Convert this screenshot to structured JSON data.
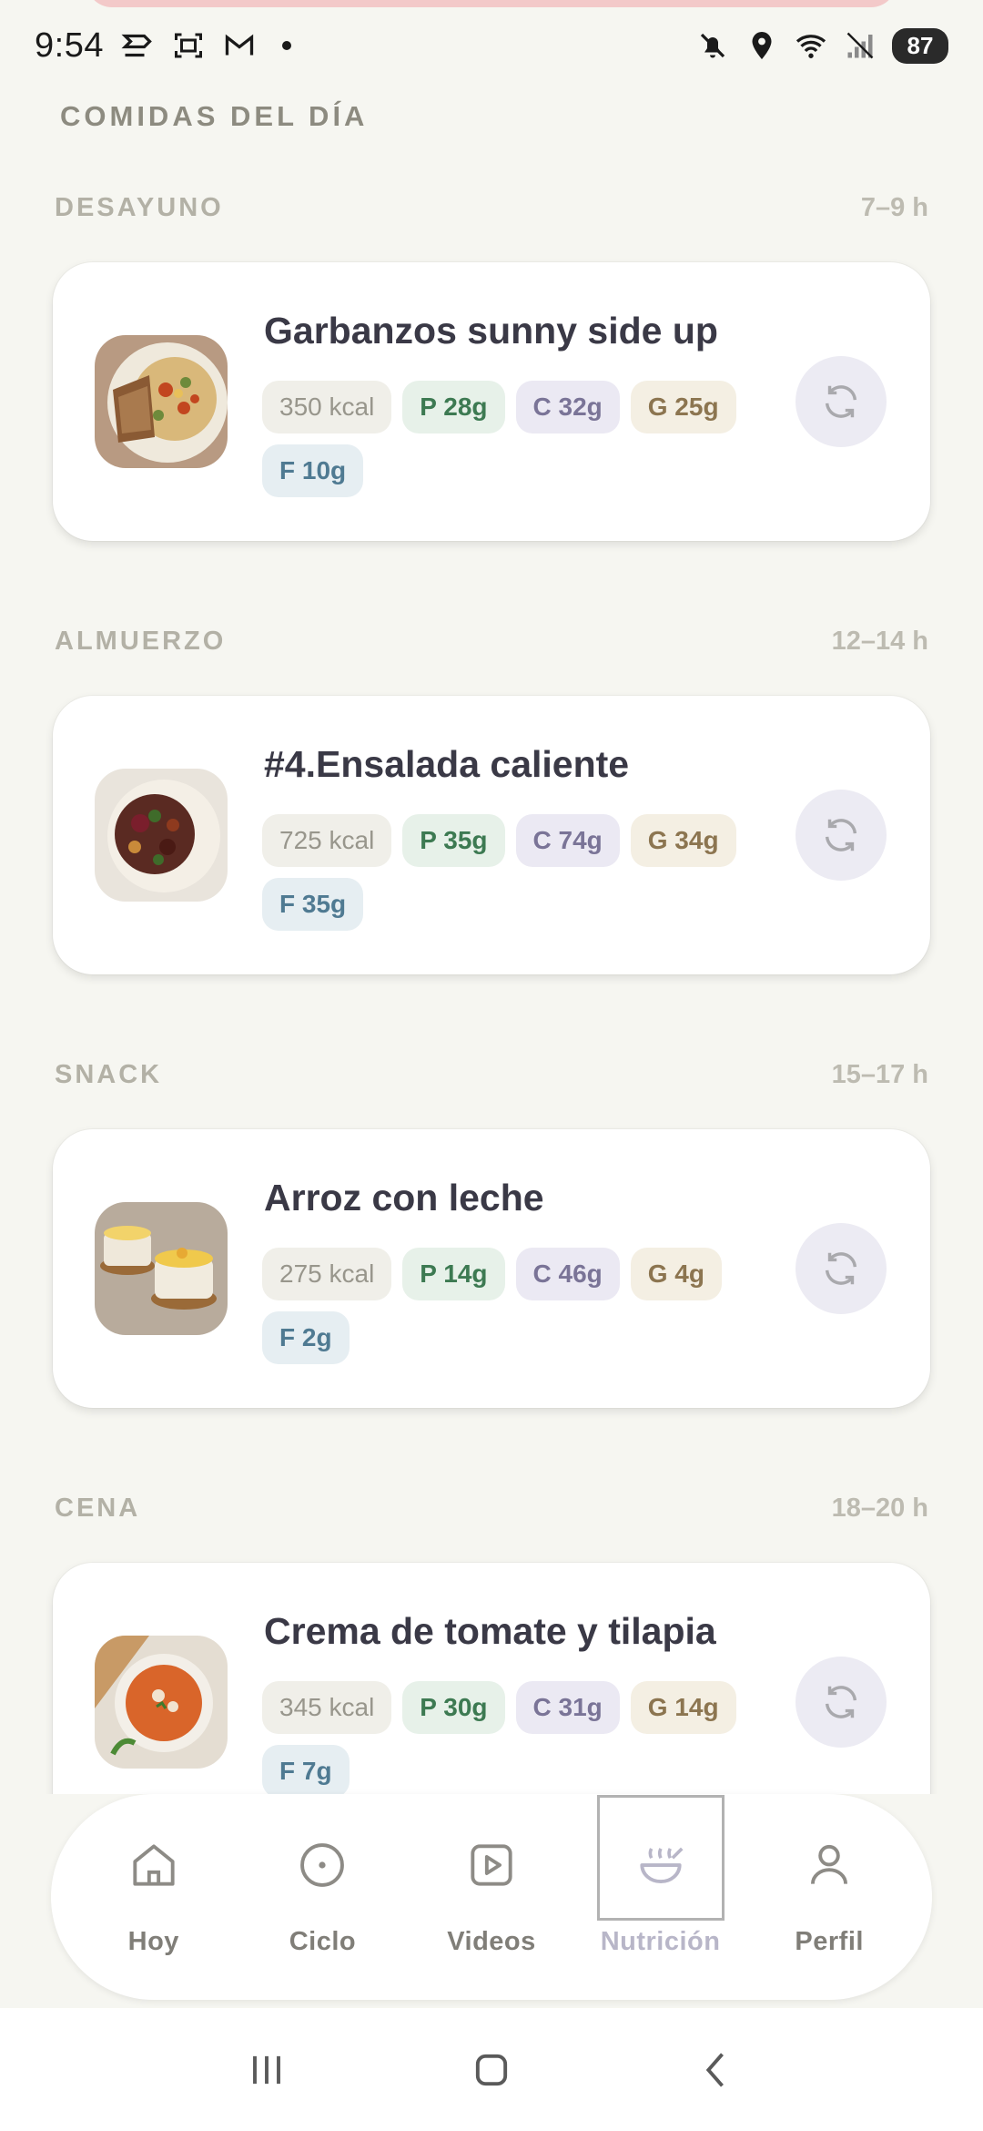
{
  "status_bar": {
    "time": "9:54",
    "battery": "87",
    "left_icons": [
      "capcut-icon",
      "screenshot-icon",
      "gmail-icon",
      "notification-dot"
    ],
    "right_icons": [
      "mute-icon",
      "location-icon",
      "wifi-icon",
      "signal-icon"
    ]
  },
  "page": {
    "section_title": "COMIDAS DEL DÍA"
  },
  "meals": [
    {
      "label": "DESAYUNO",
      "time": "7–9 h",
      "title": "Garbanzos sunny side up",
      "kcal": "350 kcal",
      "p": "P 28g",
      "c": "C 32g",
      "g": "G 25g",
      "f": "F 10g"
    },
    {
      "label": "ALMUERZO",
      "time": "12–14 h",
      "title": "#4.Ensalada caliente",
      "kcal": "725 kcal",
      "p": "P 35g",
      "c": "C 74g",
      "g": "G 34g",
      "f": "F 35g"
    },
    {
      "label": "SNACK",
      "time": "15–17 h",
      "title": "Arroz con leche",
      "kcal": "275 kcal",
      "p": "P 14g",
      "c": "C 46g",
      "g": "G 4g",
      "f": "F 2g"
    },
    {
      "label": "CENA",
      "time": "18–20 h",
      "title": "Crema de tomate y tilapia",
      "kcal": "345 kcal",
      "p": "P 30g",
      "c": "C 31g",
      "g": "G 14g",
      "f": "F 7g"
    }
  ],
  "nav": {
    "items": [
      {
        "label": "Hoy",
        "icon": "home-icon"
      },
      {
        "label": "Ciclo",
        "icon": "cycle-icon"
      },
      {
        "label": "Videos",
        "icon": "video-icon"
      },
      {
        "label": "Nutrición",
        "icon": "bowl-icon",
        "active": true
      },
      {
        "label": "Perfil",
        "icon": "profile-icon"
      }
    ]
  },
  "colors": {
    "background": "#f6f6f1",
    "card": "#ffffff",
    "protein": "#3d7a52",
    "carbs": "#7a7497",
    "fat_g": "#8c7550",
    "fiber": "#4f7a92",
    "active_nav": "#b8b6c8"
  }
}
